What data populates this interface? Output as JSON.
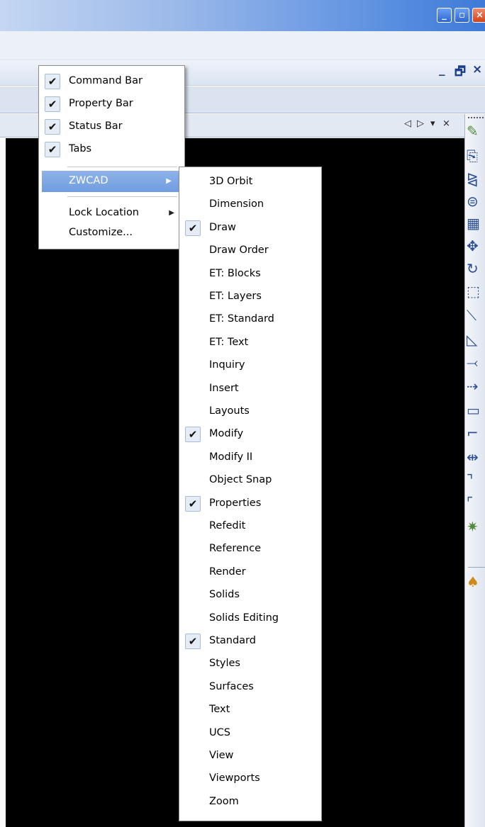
{
  "window": {
    "minimize_icon": "minimize-icon",
    "maximize_icon": "maximize-icon",
    "close_icon": "close-icon"
  },
  "mdi_controls": {
    "minimize": "_",
    "restore": "🗗",
    "close": "×"
  },
  "view_controls": {
    "prev": "◁",
    "next": "▷",
    "menu": "▾",
    "close": "×"
  },
  "context_menu": {
    "items": [
      {
        "label": "Command Bar",
        "checked": true
      },
      {
        "label": "Property Bar",
        "checked": true
      },
      {
        "label": "Status Bar",
        "checked": true
      },
      {
        "label": "Tabs",
        "checked": true
      }
    ],
    "submenu_item": {
      "label": "ZWCAD",
      "highlighted": true
    },
    "lock_location": {
      "label": "Lock Location"
    },
    "customize": {
      "label": "Customize..."
    }
  },
  "toolbars_submenu": {
    "items": [
      {
        "label": "3D Orbit",
        "checked": false
      },
      {
        "label": "Dimension",
        "checked": false
      },
      {
        "label": "Draw",
        "checked": true
      },
      {
        "label": "Draw Order",
        "checked": false
      },
      {
        "label": "ET: Blocks",
        "checked": false
      },
      {
        "label": "ET: Layers",
        "checked": false
      },
      {
        "label": "ET: Standard",
        "checked": false
      },
      {
        "label": "ET: Text",
        "checked": false
      },
      {
        "label": "Inquiry",
        "checked": false
      },
      {
        "label": "Insert",
        "checked": false
      },
      {
        "label": "Layouts",
        "checked": false
      },
      {
        "label": "Modify",
        "checked": true
      },
      {
        "label": "Modify II",
        "checked": false
      },
      {
        "label": "Object Snap",
        "checked": false
      },
      {
        "label": "Properties",
        "checked": true
      },
      {
        "label": "Refedit",
        "checked": false
      },
      {
        "label": "Reference",
        "checked": false
      },
      {
        "label": "Render",
        "checked": false
      },
      {
        "label": "Solids",
        "checked": false
      },
      {
        "label": "Solids Editing",
        "checked": false
      },
      {
        "label": "Standard",
        "checked": true
      },
      {
        "label": "Styles",
        "checked": false
      },
      {
        "label": "Surfaces",
        "checked": false
      },
      {
        "label": "Text",
        "checked": false
      },
      {
        "label": "UCS",
        "checked": false
      },
      {
        "label": "View",
        "checked": false
      },
      {
        "label": "Viewports",
        "checked": false
      },
      {
        "label": "Zoom",
        "checked": false
      }
    ]
  },
  "modify_toolbar": {
    "icons": [
      {
        "name": "erase-icon",
        "glyph": "✎"
      },
      {
        "name": "copy-icon",
        "glyph": "⎘"
      },
      {
        "name": "mirror-icon",
        "glyph": "⧎"
      },
      {
        "name": "offset-icon",
        "glyph": "⊜"
      },
      {
        "name": "array-icon",
        "glyph": "▦"
      },
      {
        "name": "move-icon",
        "glyph": "✥"
      },
      {
        "name": "rotate-icon",
        "glyph": "↻"
      },
      {
        "name": "scale-icon",
        "glyph": "⬚"
      },
      {
        "name": "stretch-icon",
        "glyph": "⟍"
      },
      {
        "name": "lengthen-icon",
        "glyph": "◺"
      },
      {
        "name": "trim-icon",
        "glyph": "⤙"
      },
      {
        "name": "extend-icon",
        "glyph": "⇢"
      },
      {
        "name": "break-at-point-icon",
        "glyph": "▭"
      },
      {
        "name": "break-icon",
        "glyph": "⌐"
      },
      {
        "name": "join-icon",
        "glyph": "⇹"
      },
      {
        "name": "chamfer-icon",
        "glyph": "⌝"
      },
      {
        "name": "fillet-icon",
        "glyph": "⌜"
      },
      {
        "name": "explode-icon",
        "glyph": "✷"
      },
      {
        "name": "properties-brush-icon",
        "glyph": "♠"
      }
    ]
  }
}
